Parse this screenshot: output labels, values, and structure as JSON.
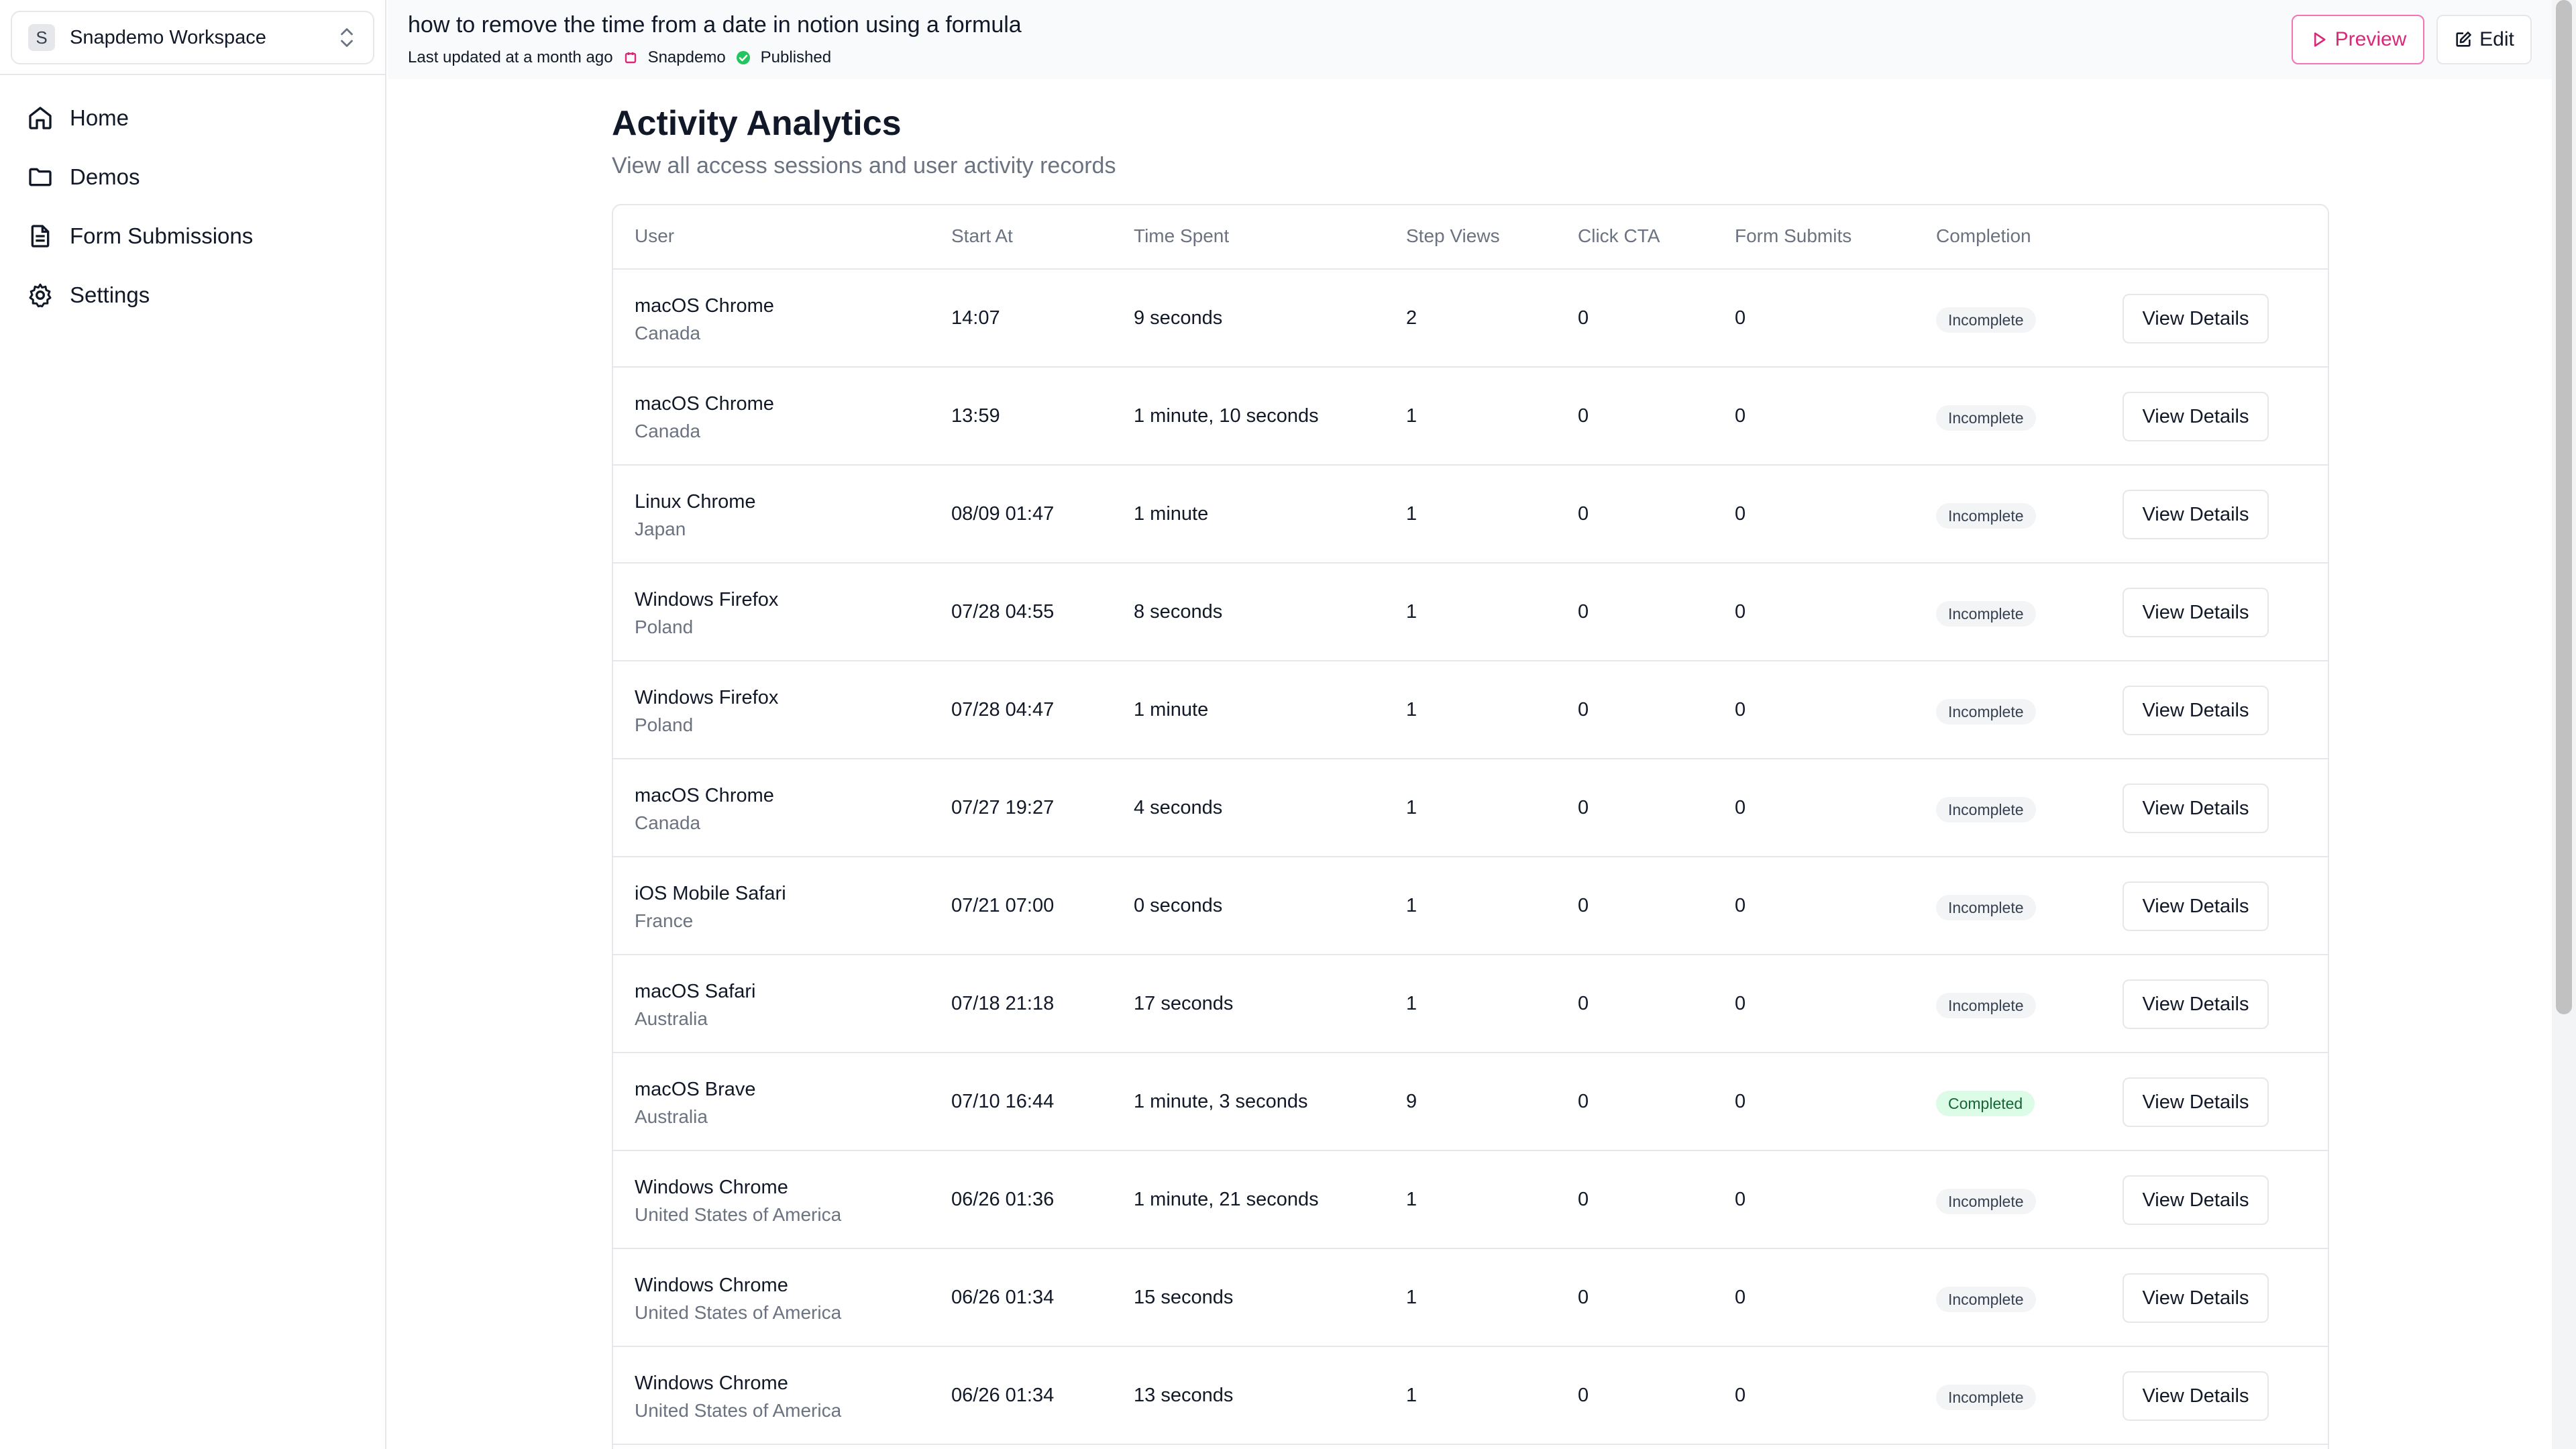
{
  "workspace": {
    "initial": "S",
    "name": "Snapdemo Workspace"
  },
  "sidebar": {
    "items": [
      {
        "label": "Home",
        "icon": "home-icon"
      },
      {
        "label": "Demos",
        "icon": "folder-icon"
      },
      {
        "label": "Form Submissions",
        "icon": "document-icon"
      },
      {
        "label": "Settings",
        "icon": "gear-icon"
      }
    ]
  },
  "header": {
    "title": "how to remove the time from a date in notion using a formula",
    "last_updated": "Last updated at a month ago",
    "brand": "Snapdemo",
    "status": "Published",
    "preview_label": "Preview",
    "edit_label": "Edit"
  },
  "colors": {
    "accent": "#db2777",
    "published": "#22c55e",
    "completed_bg": "#dcfce7"
  },
  "main": {
    "title": "Activity Analytics",
    "subtitle": "View all access sessions and user activity records"
  },
  "table": {
    "headers": [
      "User",
      "Start At",
      "Time Spent",
      "Step Views",
      "Click CTA",
      "Form Submits",
      "Completion"
    ],
    "view_label": "View Details",
    "rows": [
      {
        "user": "macOS Chrome",
        "country": "Canada",
        "start": "14:07",
        "time": "9 seconds",
        "steps": "2",
        "cta": "0",
        "forms": "0",
        "completion": "Incomplete"
      },
      {
        "user": "macOS Chrome",
        "country": "Canada",
        "start": "13:59",
        "time": "1 minute, 10 seconds",
        "steps": "1",
        "cta": "0",
        "forms": "0",
        "completion": "Incomplete"
      },
      {
        "user": "Linux Chrome",
        "country": "Japan",
        "start": "08/09 01:47",
        "time": "1 minute",
        "steps": "1",
        "cta": "0",
        "forms": "0",
        "completion": "Incomplete"
      },
      {
        "user": "Windows Firefox",
        "country": "Poland",
        "start": "07/28 04:55",
        "time": "8 seconds",
        "steps": "1",
        "cta": "0",
        "forms": "0",
        "completion": "Incomplete"
      },
      {
        "user": "Windows Firefox",
        "country": "Poland",
        "start": "07/28 04:47",
        "time": "1 minute",
        "steps": "1",
        "cta": "0",
        "forms": "0",
        "completion": "Incomplete"
      },
      {
        "user": "macOS Chrome",
        "country": "Canada",
        "start": "07/27 19:27",
        "time": "4 seconds",
        "steps": "1",
        "cta": "0",
        "forms": "0",
        "completion": "Incomplete"
      },
      {
        "user": "iOS Mobile Safari",
        "country": "France",
        "start": "07/21 07:00",
        "time": "0 seconds",
        "steps": "1",
        "cta": "0",
        "forms": "0",
        "completion": "Incomplete"
      },
      {
        "user": "macOS Safari",
        "country": "Australia",
        "start": "07/18 21:18",
        "time": "17 seconds",
        "steps": "1",
        "cta": "0",
        "forms": "0",
        "completion": "Incomplete"
      },
      {
        "user": "macOS Brave",
        "country": "Australia",
        "start": "07/10 16:44",
        "time": "1 minute, 3 seconds",
        "steps": "9",
        "cta": "0",
        "forms": "0",
        "completion": "Completed"
      },
      {
        "user": "Windows Chrome",
        "country": "United States of America",
        "start": "06/26 01:36",
        "time": "1 minute, 21 seconds",
        "steps": "1",
        "cta": "0",
        "forms": "0",
        "completion": "Incomplete"
      },
      {
        "user": "Windows Chrome",
        "country": "United States of America",
        "start": "06/26 01:34",
        "time": "15 seconds",
        "steps": "1",
        "cta": "0",
        "forms": "0",
        "completion": "Incomplete"
      },
      {
        "user": "Windows Chrome",
        "country": "United States of America",
        "start": "06/26 01:34",
        "time": "13 seconds",
        "steps": "1",
        "cta": "0",
        "forms": "0",
        "completion": "Incomplete"
      }
    ]
  }
}
